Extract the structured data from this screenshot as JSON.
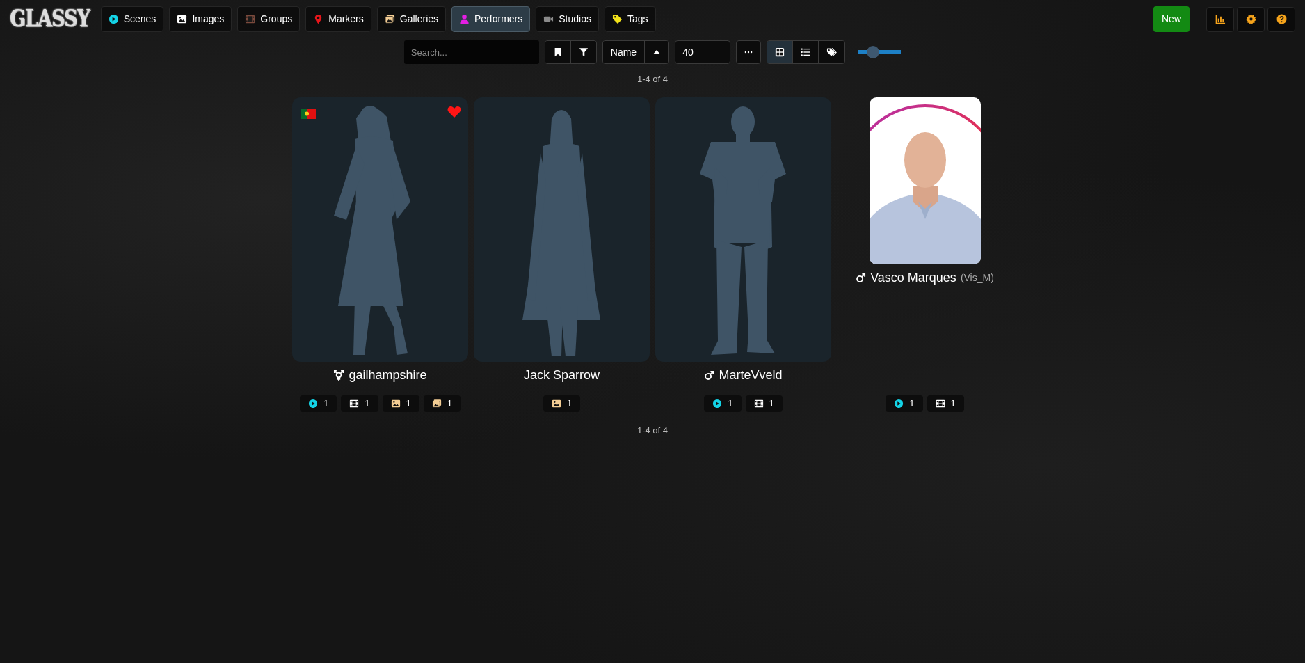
{
  "logo": "GLASSY",
  "nav": [
    {
      "label": "Scenes",
      "selected": false
    },
    {
      "label": "Images",
      "selected": false
    },
    {
      "label": "Groups",
      "selected": false
    },
    {
      "label": "Markers",
      "selected": false
    },
    {
      "label": "Galleries",
      "selected": false
    },
    {
      "label": "Performers",
      "selected": true
    },
    {
      "label": "Studios",
      "selected": false
    },
    {
      "label": "Tags",
      "selected": false
    }
  ],
  "new_button": "New",
  "toolbar": {
    "search_placeholder": "Search...",
    "sort_by": "Name",
    "per_page": "40",
    "view_modes": [
      {
        "kind": "grid",
        "selected": true
      },
      {
        "kind": "list",
        "selected": false
      },
      {
        "kind": "tagger",
        "selected": false
      }
    ],
    "zoom": {
      "level": 0.35
    }
  },
  "pagination_top": "1-4 of 4",
  "performers": [
    {
      "name": "gailhampshire",
      "flag": true,
      "favorite": true,
      "kind": "silhouette",
      "stats": [
        {
          "kind": "scenes",
          "count": "1"
        },
        {
          "kind": "groups",
          "count": "1"
        },
        {
          "kind": "images",
          "count": "1"
        },
        {
          "kind": "galleries",
          "count": "1"
        }
      ]
    },
    {
      "name": "Jack Sparrow",
      "flag": false,
      "favorite": false,
      "kind": "silhouette",
      "stats": [
        {
          "kind": "images",
          "count": "1"
        }
      ]
    },
    {
      "name": "MarteVveld",
      "flag": false,
      "favorite": false,
      "kind": "silhouette",
      "stats": [
        {
          "kind": "scenes",
          "count": "1"
        },
        {
          "kind": "groups",
          "count": "1"
        }
      ]
    },
    {
      "name": "Vasco Marques",
      "disambiguation": "(Vis_M)",
      "flag": false,
      "favorite": false,
      "stats": [
        {
          "kind": "scenes",
          "count": "1"
        },
        {
          "kind": "groups",
          "count": "1"
        }
      ]
    }
  ],
  "pagination_bottom": "1-4 of 4"
}
